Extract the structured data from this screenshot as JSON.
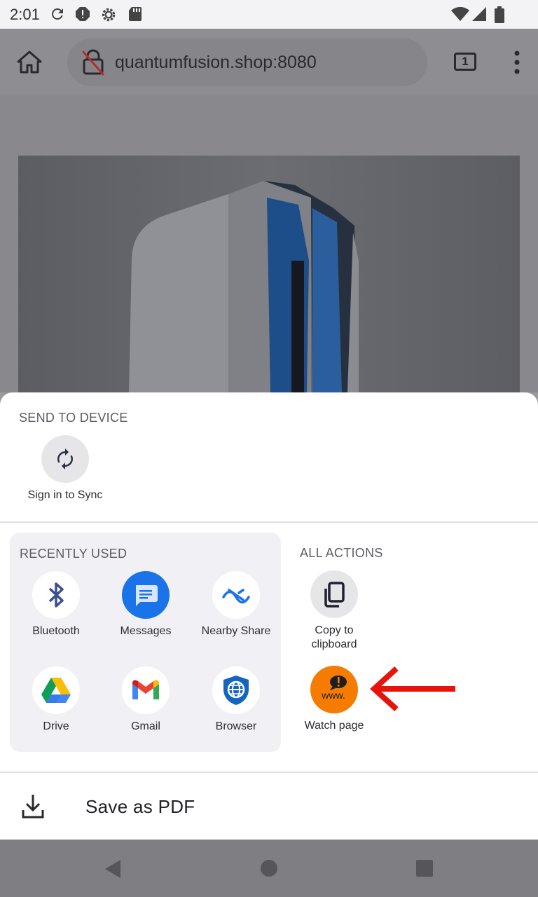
{
  "status_bar": {
    "time": "2:01",
    "icons": [
      "sync-icon",
      "alert-icon",
      "settings-icon",
      "sd-card-icon",
      "wifi-icon",
      "signal-icon",
      "battery-icon"
    ]
  },
  "browser": {
    "url": "quantumfusion.shop:8080",
    "tab_count": "1",
    "icons": [
      "home-icon",
      "insecure-lock-icon",
      "tab-switcher-icon",
      "more-vert-icon"
    ]
  },
  "share_sheet": {
    "send_to_device": {
      "heading": "SEND TO DEVICE",
      "sign_in_label": "Sign in to Sync"
    },
    "recently_used": {
      "heading": "RECENTLY USED",
      "apps": [
        {
          "label": "Bluetooth",
          "icon": "bluetooth-icon"
        },
        {
          "label": "Messages",
          "icon": "messages-icon"
        },
        {
          "label": "Nearby Share",
          "icon": "nearby-share-icon"
        },
        {
          "label": "Drive",
          "icon": "drive-icon"
        },
        {
          "label": "Gmail",
          "icon": "gmail-icon"
        },
        {
          "label": "Browser",
          "icon": "browser-icon"
        }
      ]
    },
    "all_actions": {
      "heading": "ALL ACTIONS",
      "copy_line1": "Copy to",
      "copy_line2": "clipboard",
      "watch_label": "Watch page"
    },
    "save_pdf_label": "Save as PDF"
  },
  "nav_bar": {
    "icons": [
      "back-icon",
      "home-nav-icon",
      "recents-icon"
    ]
  },
  "colors": {
    "accent_blue": "#1a73e8",
    "watch_orange": "#f57c00",
    "annotation_red": "#e8140c"
  }
}
